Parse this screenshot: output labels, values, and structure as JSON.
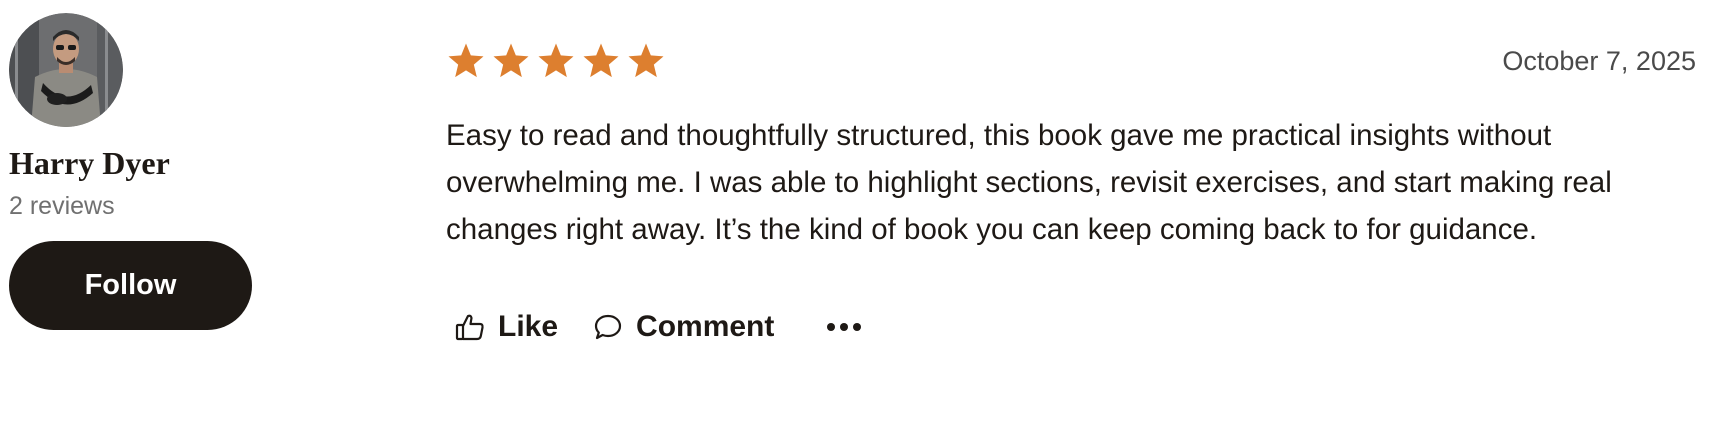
{
  "reviewer": {
    "name": "Harry Dyer",
    "reviews_count": "2 reviews",
    "follow_label": "Follow"
  },
  "review": {
    "rating": 5,
    "max_rating": 5,
    "star_color": "#dd7f2f",
    "date": "October 7, 2025",
    "text": "Easy to read and thoughtfully structured, this book gave me practical insights without overwhelming me. I was able to highlight sections, revisit exercises, and start making real changes right away. It’s the kind of book you can keep coming back to for guidance."
  },
  "actions": {
    "like_label": "Like",
    "comment_label": "Comment",
    "like_icon": "thumbs-up-icon",
    "comment_icon": "speech-bubble-icon",
    "more_icon": "more-dots-icon"
  },
  "colors": {
    "text": "#1e1915",
    "button_bg": "#1e1915",
    "button_text": "#ffffff",
    "muted": "#707070"
  }
}
